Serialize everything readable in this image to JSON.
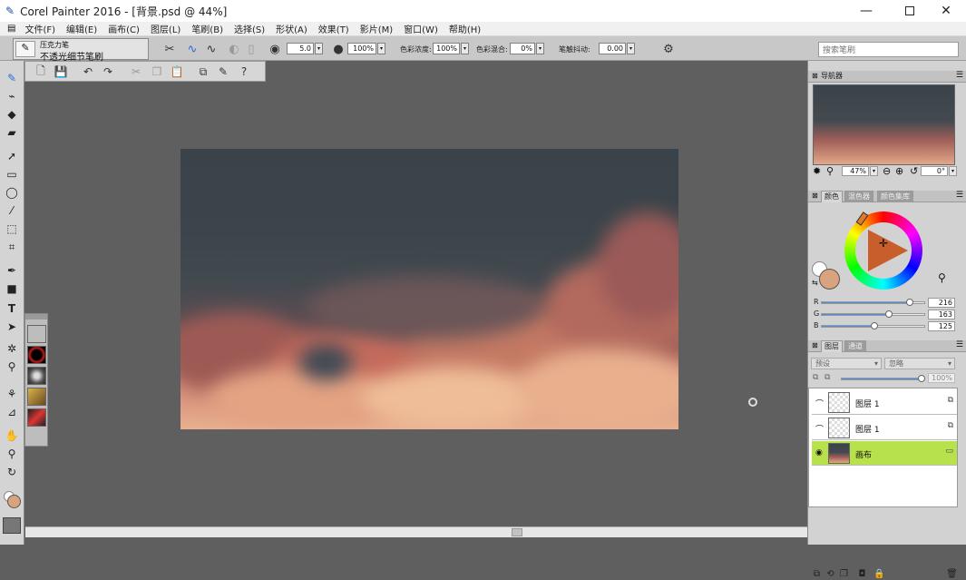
{
  "window": {
    "title": "Corel Painter 2016 - [背景.psd @ 44%]",
    "min_icon": "minimize-icon",
    "max_icon": "maximize-icon",
    "close_icon": "close-icon"
  },
  "menu": {
    "items": [
      "文件(F)",
      "编辑(E)",
      "画布(C)",
      "图层(L)",
      "笔刷(B)",
      "选择(S)",
      "形状(A)",
      "效果(T)",
      "影片(M)",
      "窗口(W)",
      "帮助(H)"
    ]
  },
  "brush": {
    "category": "压克力笔",
    "variant": "不透光细节笔刷"
  },
  "property_bar": {
    "size_value": "5.0",
    "opacity_value": "100%",
    "color_density_label": "色彩浓度:",
    "color_density_value": "100%",
    "color_mix_label": "色彩混合:",
    "color_mix_value": "0%",
    "jitter_label": "笔触抖动:",
    "jitter_value": "0.00"
  },
  "search": {
    "placeholder": "搜索笔刷"
  },
  "navigator": {
    "title": "导航器",
    "zoom": "47%",
    "rotation": "0°"
  },
  "color_panel": {
    "tabs": [
      "颜色",
      "混色器",
      "颜色集库"
    ],
    "r_label": "R",
    "g_label": "G",
    "b_label": "B",
    "r": "216",
    "g": "163",
    "b": "125",
    "main_color": "#d8a37d",
    "secondary_color": "#ffffff"
  },
  "layers_panel": {
    "tabs": [
      "图层",
      "通道"
    ],
    "composite_method": "预设",
    "composite_depth": "忽略",
    "opacity": "100%",
    "layers": [
      {
        "name": "图层 1",
        "selected": false
      },
      {
        "name": "图层 1",
        "selected": false
      },
      {
        "name": "画布",
        "selected": true
      }
    ],
    "selected_color": "#b8e24c"
  },
  "colors": {
    "workspace": "#5f5f5f",
    "panel": "#d2d2d2",
    "accent": "#4d8ee0"
  }
}
